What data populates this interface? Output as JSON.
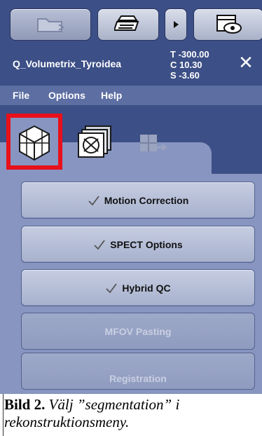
{
  "app": {
    "title": "Q_Volumetrix_Tyroidea",
    "coords": {
      "t": "T -300.00",
      "c": "C 10.30",
      "s": "S -3.60"
    },
    "close_glyph": "✕"
  },
  "toolbar": {
    "buttons": [
      {
        "icon": "folder-icon"
      },
      {
        "icon": "printer-icon"
      },
      {
        "icon": "arrow-right-icon"
      },
      {
        "icon": "screen-view-icon"
      }
    ]
  },
  "menubar": {
    "items": [
      "File",
      "Options",
      "Help"
    ]
  },
  "tabs": [
    {
      "icon": "volume-cube-icon",
      "active": true
    },
    {
      "icon": "stacked-slices-icon",
      "active": false
    },
    {
      "icon": "grid-export-icon",
      "active": false
    }
  ],
  "panel": {
    "buttons": [
      {
        "label": "Motion Correction",
        "checked": true,
        "enabled": true
      },
      {
        "label": "SPECT Options",
        "checked": true,
        "enabled": true
      },
      {
        "label": "Hybrid QC",
        "checked": true,
        "enabled": true
      },
      {
        "label": "MFOV Pasting",
        "checked": false,
        "enabled": false
      },
      {
        "label": "Registration",
        "checked": false,
        "enabled": false
      }
    ]
  },
  "caption": {
    "label": "Bild 2.",
    "text": "Välj ”segmentation” i rekonstruktionsmeny."
  },
  "colors": {
    "highlight": "#e8101a",
    "background": "#3c4f86",
    "panel": "#8795c0"
  }
}
